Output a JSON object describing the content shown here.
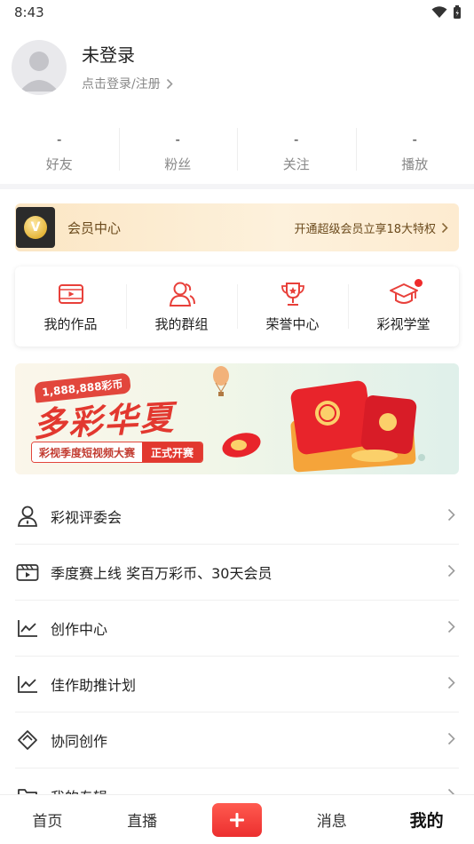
{
  "status_bar": {
    "time": "8:43"
  },
  "profile": {
    "name": "未登录",
    "login_link": "点击登录/注册"
  },
  "stats": [
    {
      "value": "-",
      "label": "好友"
    },
    {
      "value": "-",
      "label": "粉丝"
    },
    {
      "value": "-",
      "label": "关注"
    },
    {
      "value": "-",
      "label": "播放"
    }
  ],
  "vip": {
    "title": "会员中心",
    "cta": "开通超级会员立享18大特权",
    "badge_glyph": "V"
  },
  "tools": [
    {
      "label": "我的作品",
      "icon": "video-icon"
    },
    {
      "label": "我的群组",
      "icon": "group-icon"
    },
    {
      "label": "荣誉中心",
      "icon": "trophy-icon"
    },
    {
      "label": "彩视学堂",
      "icon": "graduation-cap-icon"
    }
  ],
  "banner": {
    "prize": "1,888,888彩币",
    "title": "多彩华夏",
    "subtitle": "彩视季度短视频大赛",
    "button": "正式开赛"
  },
  "menu": [
    {
      "label": "彩视评委会",
      "icon": "judge-icon"
    },
    {
      "label": "季度赛上线 奖百万彩币、30天会员",
      "icon": "clapperboard-icon"
    },
    {
      "label": "创作中心",
      "icon": "line-chart-icon"
    },
    {
      "label": "佳作助推计划",
      "icon": "line-chart-icon"
    },
    {
      "label": "协同创作",
      "icon": "collab-icon"
    },
    {
      "label": "我的专辑",
      "icon": "folder-icon"
    }
  ],
  "tabbar": [
    {
      "label": "首页"
    },
    {
      "label": "直播"
    },
    {
      "label": "",
      "icon": "plus-icon"
    },
    {
      "label": "消息"
    },
    {
      "label": "我的"
    }
  ],
  "colors": {
    "accent": "#ec2f2f",
    "vip_text": "#6b4a1c",
    "muted": "#888888"
  }
}
